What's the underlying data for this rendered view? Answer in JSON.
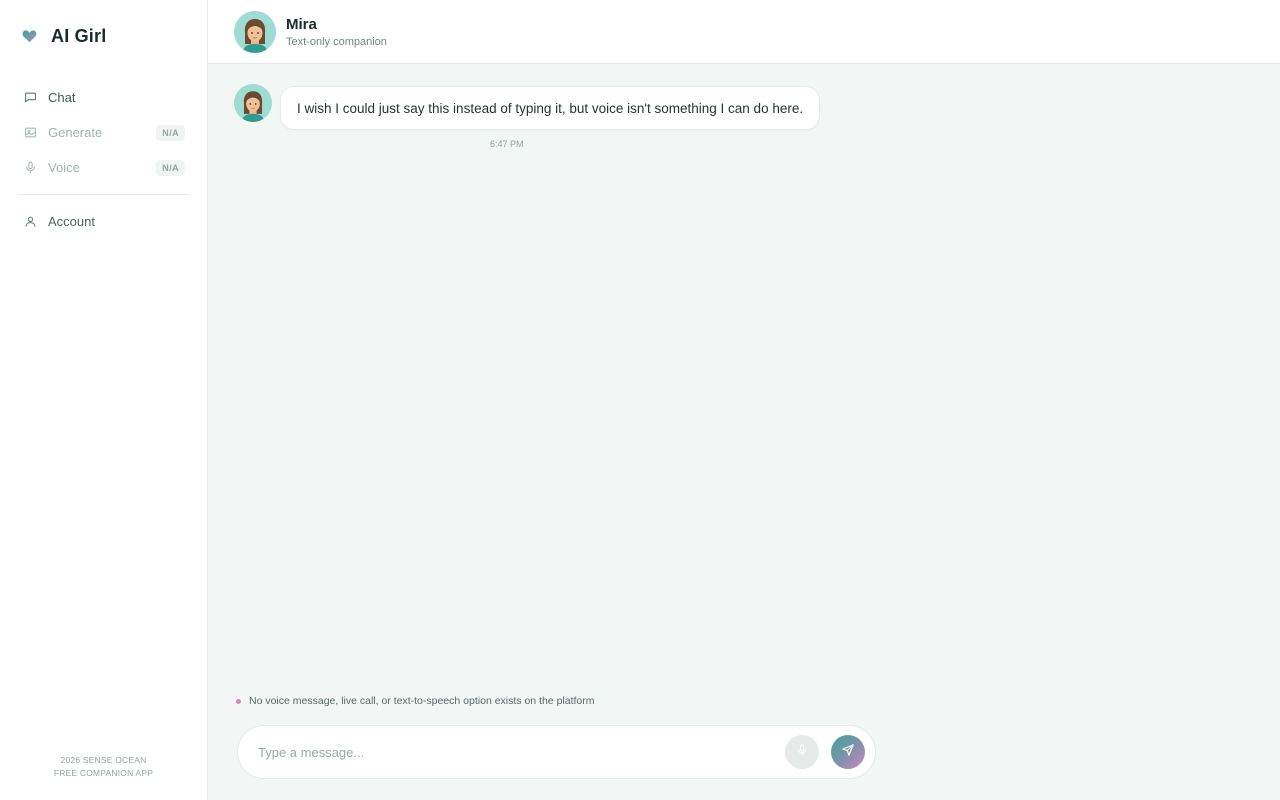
{
  "app": {
    "title": "AI Girl",
    "brand_icon": "heart-icon"
  },
  "sidebar": {
    "items": [
      {
        "label": "Chat",
        "icon": "chat-bubble-icon",
        "state": "active"
      },
      {
        "label": "Generate",
        "icon": "image-icon",
        "badge": "N/A",
        "state": "disabled"
      },
      {
        "label": "Voice",
        "icon": "microphone-icon",
        "badge": "N/A",
        "state": "disabled"
      },
      {
        "label": "Account",
        "icon": "user-icon",
        "state": "normal"
      }
    ],
    "footer": {
      "line1": "2026 SENSE OCEAN",
      "line2": "FREE COMPANION APP"
    }
  },
  "header": {
    "name": "Mira",
    "subtitle": "Text-only companion"
  },
  "messages": [
    {
      "sender": "Mira",
      "text": "I wish I could just say this instead of typing it, but voice isn't something I can do here.",
      "time": "6:47 PM"
    }
  ],
  "notice": {
    "text": "No voice message, live call, or text-to-speech option exists on the platform"
  },
  "composer": {
    "placeholder": "Type a message...",
    "value": ""
  },
  "colors": {
    "accent_teal": "#3fa497",
    "accent_pink": "#d48cbc",
    "background": "#f2f7f6",
    "avatar_bg": "#9fdcd2"
  }
}
